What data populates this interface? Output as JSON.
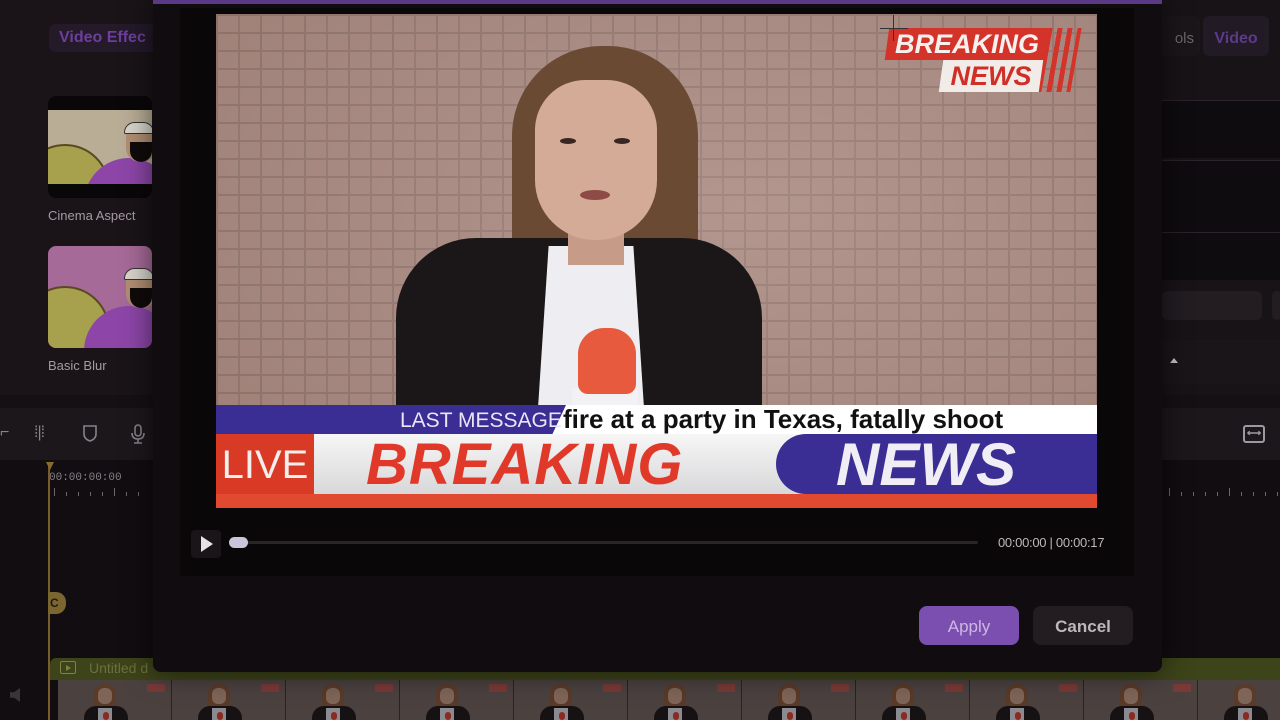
{
  "left_panel": {
    "tab_label": "Video Effec",
    "effects": [
      {
        "label": "Cinema Aspect"
      },
      {
        "label": "Basic Blur"
      }
    ]
  },
  "right_panel": {
    "tab_tools_label": "ols",
    "tab_video_label": "Video"
  },
  "timeline": {
    "timecode": "00:00:00:00",
    "playhead_marker": "C",
    "track_title": "Untitled d"
  },
  "modal": {
    "video": {
      "logo_line1": "BREAKING",
      "logo_line2": "NEWS",
      "last_message_label": "LAST MESSAGE",
      "ticker_text": "fire at a party in Texas, fatally shoot",
      "live_label": "LIVE",
      "breaking_label": "BREAKING",
      "news_label": "NEWS"
    },
    "player": {
      "current_time": "00:00:00",
      "duration": "00:00:17",
      "time_separator": "|",
      "progress": 0.0
    },
    "buttons": {
      "apply_label": "Apply",
      "cancel_label": "Cancel"
    }
  },
  "colors": {
    "accent_purple": "#7a4fb0",
    "news_blue": "#3a2d94",
    "breaking_red": "#e0392a"
  }
}
